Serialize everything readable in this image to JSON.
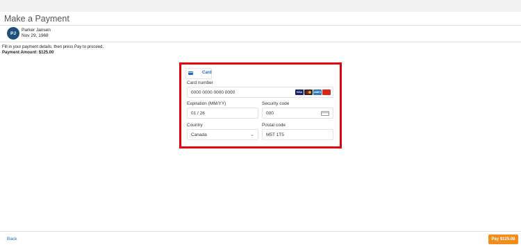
{
  "header": {
    "title": "Make a Payment"
  },
  "patient": {
    "initials": "PJ",
    "name": "Parker Jansen",
    "dob": "Nov 29, 1968"
  },
  "instructions": "Fill in your payment details, then press Pay to proceed.",
  "payment_amount": "Payment Amount: $125.00",
  "form": {
    "tab_label": "Card",
    "card_number": {
      "label": "Card number",
      "value": "0000 0000 0000 0000"
    },
    "card_brands": [
      "VISA",
      "mastercard",
      "AMEX",
      "UnionPay"
    ],
    "expiration": {
      "label": "Expiration (MM/YY)",
      "value": "01 / 26"
    },
    "security_code": {
      "label": "Security code",
      "value": "000"
    },
    "country": {
      "label": "Country",
      "value": "Canada"
    },
    "postal_code": {
      "label": "Postal code",
      "value": "M5T 1T5"
    }
  },
  "footer": {
    "back_label": "Back",
    "pay_label": "Pay $125.00"
  },
  "colors": {
    "accent": "#1f66c1",
    "highlight": "#e0000a",
    "pay_button": "#f28c1a",
    "avatar": "#1f4f7a"
  }
}
